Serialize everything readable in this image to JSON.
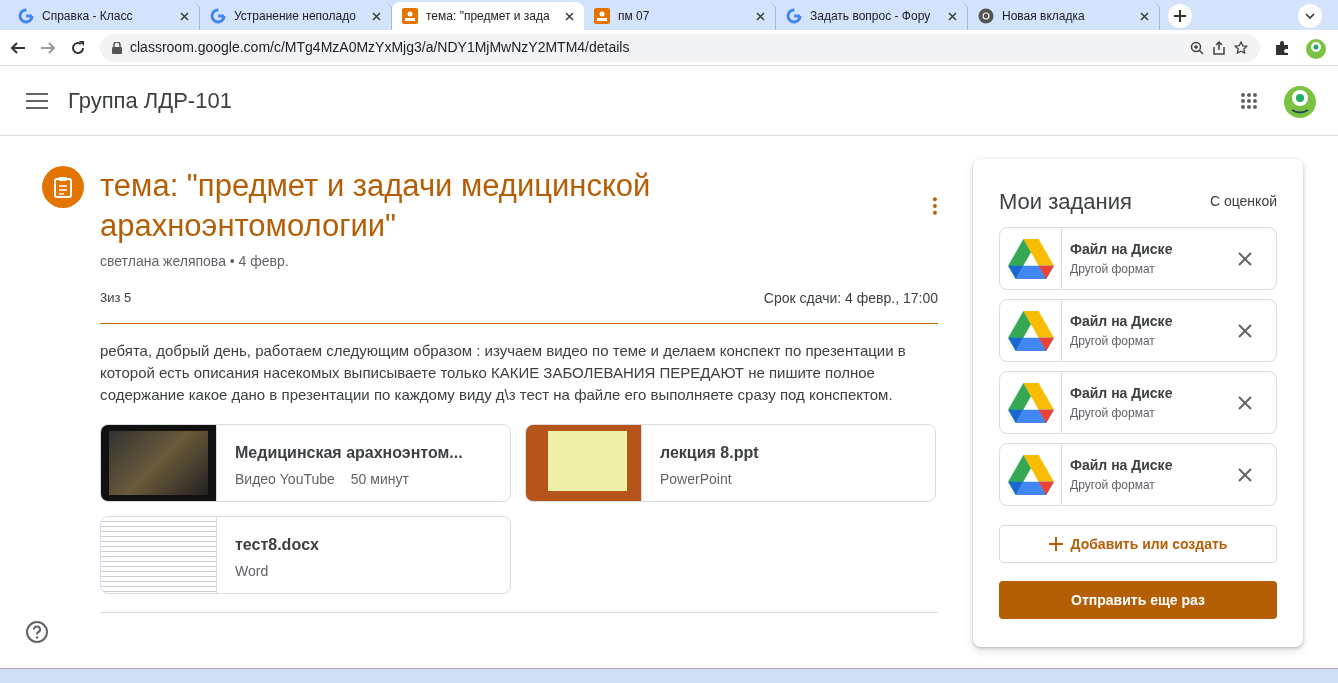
{
  "browser": {
    "tabs": [
      {
        "title": "Справка - Класс",
        "kind": "google",
        "selected": false
      },
      {
        "title": "Устранение неполадо",
        "kind": "google",
        "selected": false
      },
      {
        "title": "тема: \"предмет и зада",
        "kind": "classroom",
        "selected": true
      },
      {
        "title": "пм 07",
        "kind": "classroom",
        "selected": false
      },
      {
        "title": "Задать вопрос - Фору",
        "kind": "google",
        "selected": false
      },
      {
        "title": "Новая вкладка",
        "kind": "chrome",
        "selected": false
      }
    ],
    "url": "classroom.google.com/c/MTg4MzA0MzYxMjg3/a/NDY1MjMwNzY2MTM4/details"
  },
  "app_bar": {
    "title": "Группа ЛДР-101"
  },
  "assignment": {
    "title": "тема: \"предмет и задачи медицинской арахноэнтомологии\"",
    "author_date": "светлана желяпова • 4 февр.",
    "points": "3из 5",
    "due": "Срок сдачи: 4 февр., 17:00",
    "description": "ребята, добрый день, работаем следующим образом : изучаем видео по теме и  делаем конспект по презентации в которой есть описания  насекомых   выписываете только КАКИЕ ЗАБОЛЕВАНИЯ ПЕРЕДАЮТ  не пишите полное содержание какое дано в  презентации по  каждому виду  д\\з тест на  файле его выполняете сразу под конспектом.",
    "attachments": [
      {
        "kind": "video",
        "title": "Медицинская арахноэнтом...",
        "subtitle": "Видео YouTube",
        "extra": "50 минут"
      },
      {
        "kind": "slides",
        "title": "лекция 8.ppt",
        "subtitle": "PowerPoint"
      },
      {
        "kind": "document",
        "title": "тест8.docx",
        "subtitle": "Word"
      }
    ]
  },
  "my_work": {
    "title": "Мои задания",
    "status": "С оценкой",
    "files": [
      {
        "title": "Файл на Диске",
        "subtitle": "Другой формат"
      },
      {
        "title": "Файл на Диске",
        "subtitle": "Другой формат"
      },
      {
        "title": "Файл на Диске",
        "subtitle": "Другой формат"
      },
      {
        "title": "Файл на Диске",
        "subtitle": "Другой формат"
      }
    ],
    "add_button": "Добавить или создать",
    "resubmit_button": "Отправить еще раз"
  }
}
